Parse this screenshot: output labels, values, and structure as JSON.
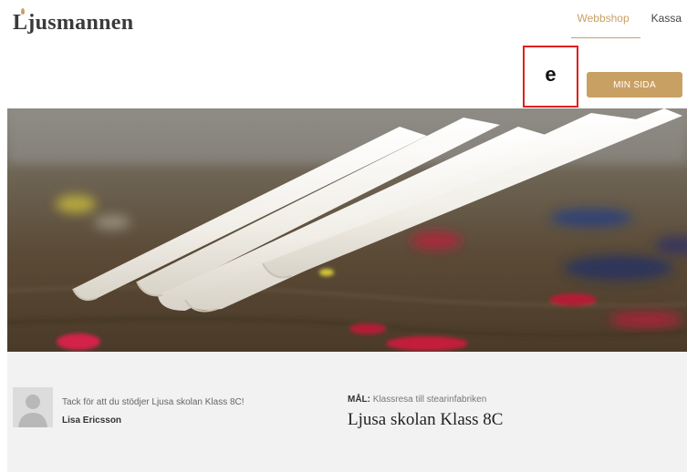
{
  "header": {
    "logo_text": "Ljusmannen",
    "nav": {
      "webbshop": "Webbshop",
      "kassa": "Kassa"
    }
  },
  "marker_label": "e",
  "min_sida_label": "MIN SIDA",
  "hero": {
    "palette": {
      "wood": "#5a4a36",
      "candle": "#f4f1ea",
      "paint_red": "#c41e3a",
      "paint_blue": "#1f3a8a"
    }
  },
  "support": {
    "thanks_text": "Tack för att du stödjer Ljusa skolan Klass 8C!",
    "supporter_name": "Lisa Ericsson",
    "goal_label": "MÅL:",
    "goal_text": "Klassresa till stearinfabriken",
    "campaign_title": "Ljusa skolan Klass 8C"
  },
  "colors": {
    "accent": "#c9a064",
    "marker": "#e0201d",
    "band": "#f2f2f2"
  }
}
